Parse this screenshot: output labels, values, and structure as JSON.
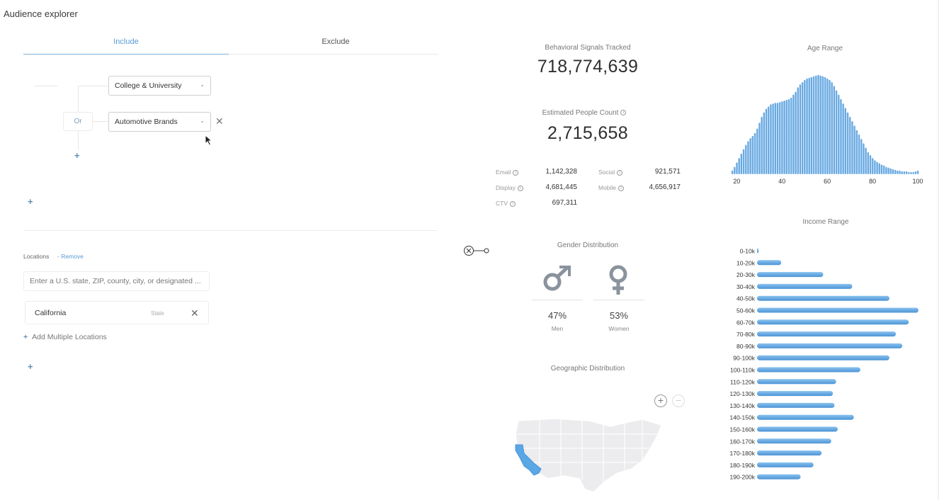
{
  "app": {
    "title": "Audience explorer"
  },
  "tabs": [
    {
      "label": "Include",
      "active": true
    },
    {
      "label": "Exclude",
      "active": false
    }
  ],
  "segments": {
    "first": "College & University",
    "or_label": "Or",
    "second": "Automotive Brands",
    "remove_glyph": "✕"
  },
  "locations": {
    "label": "Locations",
    "remove_label": "- Remove",
    "placeholder": "Enter a U.S. state, ZIP, county, city, or designated ...",
    "chip": {
      "name": "California",
      "type": "State"
    },
    "add_multiple": "Add Multiple Locations"
  },
  "stats": {
    "signals_title": "Behavioral Signals Tracked",
    "signals_value": "718,774,639",
    "people_title": "Estimated People Count",
    "people_value": "2,715,658",
    "channels": [
      {
        "label": "Email",
        "value": "1,142,328"
      },
      {
        "label": "Social",
        "value": "921,571"
      },
      {
        "label": "Display",
        "value": "4,681,445"
      },
      {
        "label": "Mobile",
        "value": "4,656,917"
      },
      {
        "label": "CTV",
        "value": "697,311"
      }
    ]
  },
  "gender": {
    "title": "Gender Distribution",
    "men_pct": "47%",
    "men_label": "Men",
    "women_pct": "53%",
    "women_label": "Women"
  },
  "geo": {
    "title": "Geographic Distribution",
    "highlighted_state": "California"
  },
  "colors": {
    "accent": "#5b9bd5",
    "bar": "#6aaee6",
    "bar_dark": "#4d94d6"
  },
  "chart_data": [
    {
      "type": "bar",
      "title": "Age Range",
      "x_ticks": [
        "20",
        "40",
        "60",
        "80",
        "100"
      ],
      "xlim": [
        18,
        100
      ],
      "x": [
        18,
        19,
        20,
        21,
        22,
        23,
        24,
        25,
        26,
        27,
        28,
        29,
        30,
        31,
        32,
        33,
        34,
        35,
        36,
        37,
        38,
        39,
        40,
        41,
        42,
        43,
        44,
        45,
        46,
        47,
        48,
        49,
        50,
        51,
        52,
        53,
        54,
        55,
        56,
        57,
        58,
        59,
        60,
        61,
        62,
        63,
        64,
        65,
        66,
        67,
        68,
        69,
        70,
        71,
        72,
        73,
        74,
        75,
        76,
        77,
        78,
        79,
        80,
        81,
        82,
        83,
        84,
        85,
        86,
        87,
        88,
        89,
        90,
        91,
        92,
        93,
        94,
        95,
        96,
        97,
        98,
        99,
        100
      ],
      "values": [
        5,
        10,
        16,
        22,
        28,
        34,
        40,
        45,
        49,
        52,
        56,
        62,
        70,
        78,
        84,
        89,
        92,
        95,
        96,
        97,
        97,
        98,
        99,
        100,
        101,
        102,
        104,
        108,
        112,
        118,
        122,
        125,
        128,
        130,
        131,
        132,
        133,
        134,
        135,
        134,
        133,
        132,
        130,
        128,
        125,
        120,
        114,
        108,
        102,
        96,
        90,
        84,
        78,
        72,
        66,
        60,
        54,
        48,
        42,
        36,
        30,
        26,
        22,
        19,
        17,
        15,
        13,
        12,
        10,
        9,
        8,
        7,
        6,
        5,
        5,
        4,
        4,
        4,
        3,
        3,
        3,
        4,
        5
      ],
      "ylim": [
        0,
        150
      ]
    },
    {
      "type": "bar",
      "orientation": "horizontal",
      "title": "Income Range",
      "categories": [
        "0-10k",
        "10-20k",
        "20-30k",
        "30-40k",
        "40-50k",
        "50-60k",
        "60-70k",
        "70-80k",
        "80-90k",
        "90-100k",
        "100-110k",
        "110-120k",
        "120-130k",
        "130-140k",
        "140-150k",
        "150-160k",
        "160-170k",
        "170-180k",
        "180-190k",
        "190-200k"
      ],
      "values": [
        1,
        15,
        41,
        59,
        82,
        100,
        94,
        86,
        90,
        82,
        64,
        49,
        47,
        48,
        60,
        50,
        46,
        40,
        35,
        27
      ],
      "xlim": [
        0,
        100
      ]
    }
  ]
}
